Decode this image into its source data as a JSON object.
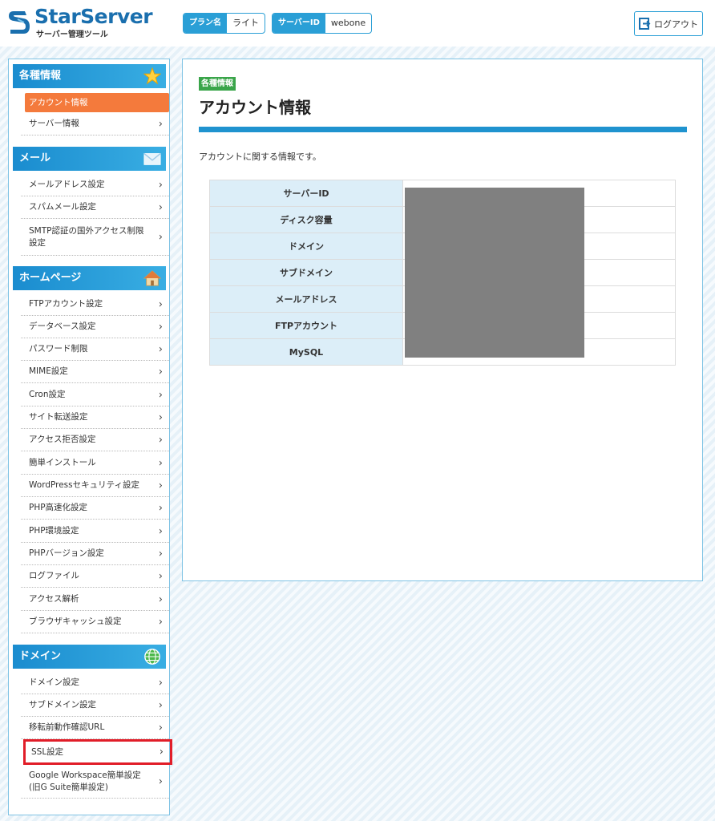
{
  "header": {
    "logo_name": "StarServer",
    "logo_sub": "サーバー管理ツール",
    "plan": {
      "label": "プラン名",
      "value": "ライト"
    },
    "server_id": {
      "label": "サーバーID",
      "value": "webone"
    },
    "logout_label": "ログアウト"
  },
  "sidebar": {
    "sections": [
      {
        "title": "各種情報",
        "icon": "star-icon",
        "items": [
          {
            "label": "アカウント情報",
            "active": true
          },
          {
            "label": "サーバー情報"
          }
        ]
      },
      {
        "title": "メール",
        "icon": "mail-icon",
        "items": [
          {
            "label": "メールアドレス設定"
          },
          {
            "label": "スパムメール設定"
          },
          {
            "label": "SMTP認証の国外アクセス制限設定"
          }
        ]
      },
      {
        "title": "ホームページ",
        "icon": "home-icon",
        "items": [
          {
            "label": "FTPアカウント設定"
          },
          {
            "label": "データベース設定"
          },
          {
            "label": "パスワード制限"
          },
          {
            "label": "MIME設定"
          },
          {
            "label": "Cron設定"
          },
          {
            "label": "サイト転送設定"
          },
          {
            "label": "アクセス拒否設定"
          },
          {
            "label": "簡単インストール"
          },
          {
            "label": "WordPressセキュリティ設定"
          },
          {
            "label": "PHP高速化設定"
          },
          {
            "label": "PHP環境設定"
          },
          {
            "label": "PHPバージョン設定"
          },
          {
            "label": "ログファイル"
          },
          {
            "label": "アクセス解析"
          },
          {
            "label": "ブラウザキャッシュ設定"
          }
        ]
      },
      {
        "title": "ドメイン",
        "icon": "globe-icon",
        "items": [
          {
            "label": "ドメイン設定"
          },
          {
            "label": "サブドメイン設定"
          },
          {
            "label": "移転前動作確認URL"
          },
          {
            "label": "SSL設定",
            "highlighted": true
          },
          {
            "label": "Google Workspace簡単設定(旧G Suite簡単設定)"
          }
        ]
      }
    ]
  },
  "main": {
    "badge": "各種情報",
    "title": "アカウント情報",
    "description": "アカウントに関する情報です。",
    "rows": [
      {
        "label": "サーバーID",
        "value": ""
      },
      {
        "label": "ディスク容量",
        "value": ""
      },
      {
        "label": "ドメイン",
        "value": ""
      },
      {
        "label": "サブドメイン",
        "value": ""
      },
      {
        "label": "メールアドレス",
        "value": ""
      },
      {
        "label": "FTPアカウント",
        "value": ""
      },
      {
        "label": "MySQL",
        "value": ""
      }
    ]
  },
  "colors": {
    "brand": "#1a6fae",
    "accent": "#2a9fd6",
    "active": "#f47a3c",
    "highlight": "#e11d28",
    "badge": "#3aa54a"
  }
}
